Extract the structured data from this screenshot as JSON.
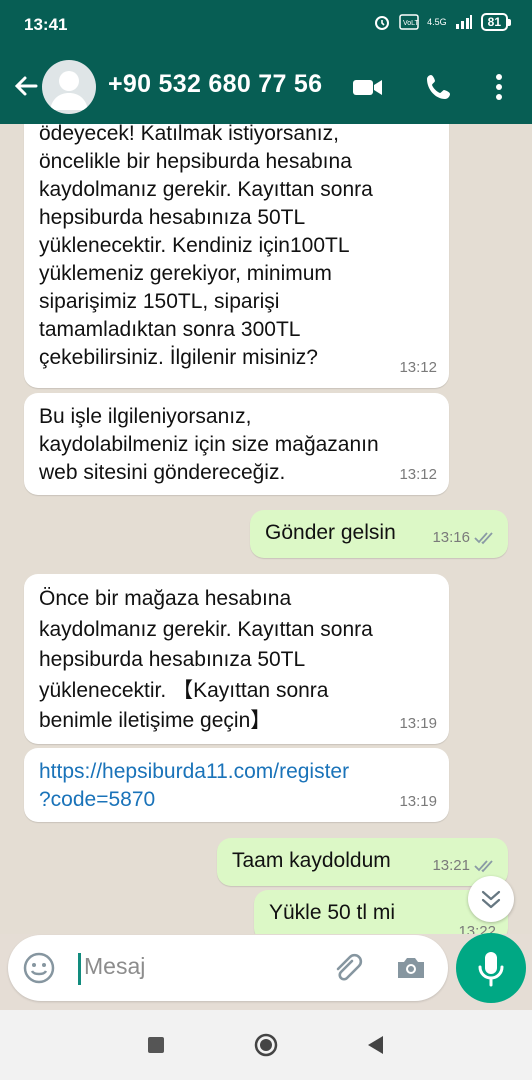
{
  "status": {
    "time": "13:41",
    "network": "4.5G",
    "battery": "81"
  },
  "header": {
    "contact": "+90 532 680 77 56"
  },
  "messages": [
    {
      "dir": "in",
      "text": "ödeyecek! Katılmak istiyorsanız,\nöncelikle bir hepsiburda hesabına\nkaydolmanız gerekir. Kayıttan sonra\nhepsiburda hesabınıza 50TL\nyüklenecektir. Kendiniz için100TL\nyüklemeniz gerekiyor, minimum\nsiparişimiz 150TL, siparişi\ntamamladıktan sonra 300TL\nçekebilirsiniz. İlgilenir misiniz?",
      "time": "13:12"
    },
    {
      "dir": "in",
      "text": "Bu işle ilgileniyorsanız,\nkaydolabilmeniz için size mağazanın\nweb sitesini göndereceğiz.",
      "time": "13:12"
    },
    {
      "dir": "out",
      "text": "Gönder gelsin",
      "time": "13:16"
    },
    {
      "dir": "in",
      "text": "Önce bir mağaza hesabına\nkaydolmanız gerekir. Kayıttan sonra\nhepsiburda hesabınıza 50TL\nyüklenecektir. 【Kayıttan sonra\nbenimle iletişime geçin】",
      "time": "13:19"
    },
    {
      "dir": "in",
      "text": "https://hepsiburda11.com/register\n?code=5870",
      "time": "13:19"
    },
    {
      "dir": "out",
      "text": "Taam kaydoldum",
      "time": "13:21"
    },
    {
      "dir": "out",
      "text": "Yükle 50 tl mi",
      "time": "13:22"
    }
  ],
  "composer": {
    "placeholder": "Mesaj"
  },
  "colors": {
    "header": "#075e54",
    "outgoing": "#dcf8c6",
    "incoming": "#ffffff",
    "accent": "#00a884",
    "link": "#1a73b9"
  },
  "icons": [
    "back-arrow-icon",
    "avatar-icon",
    "video-call-icon",
    "phone-icon",
    "more-icon",
    "emoji-icon",
    "attach-icon",
    "camera-icon",
    "mic-icon",
    "scroll-down-icon",
    "double-check-icon"
  ]
}
